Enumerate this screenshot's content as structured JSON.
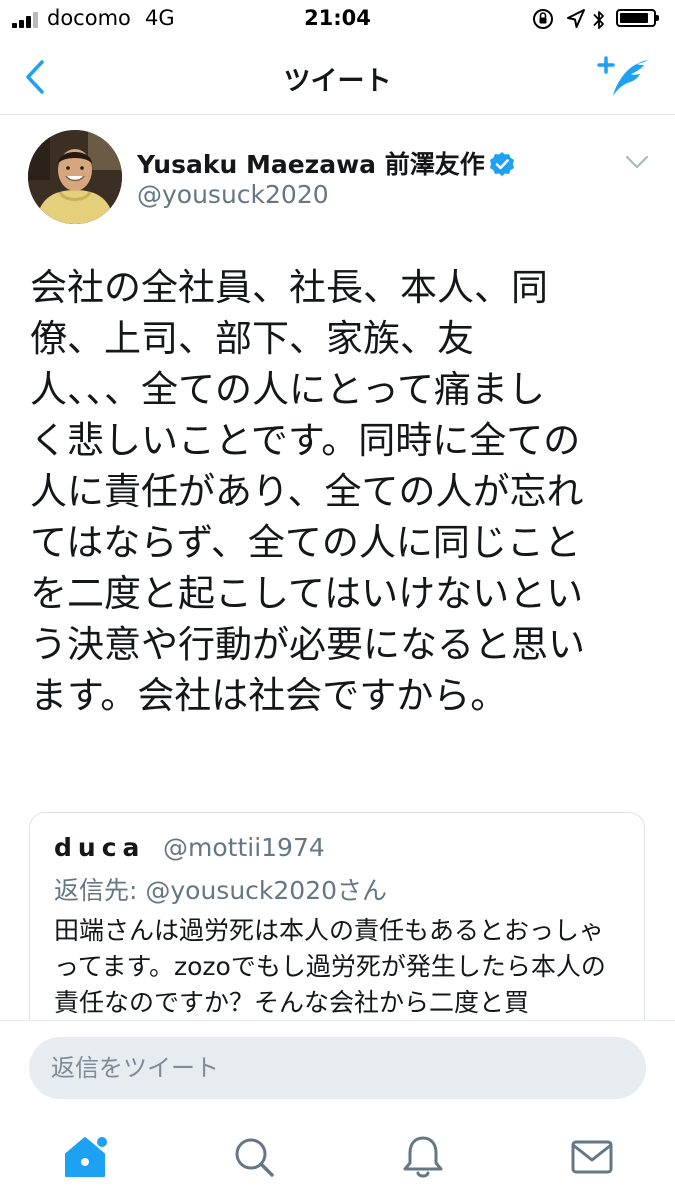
{
  "status_bar": {
    "carrier": "docomo",
    "network": "4G",
    "time": "21:04",
    "icons": [
      "signal-icon",
      "orientation-lock-icon",
      "location-icon",
      "bluetooth-icon",
      "battery-icon"
    ]
  },
  "nav": {
    "title": "ツイート",
    "back_icon": "chevron-left-icon",
    "compose_icon": "compose-tweet-icon"
  },
  "tweet": {
    "author_name": "Yusaku Maezawa 前澤友作",
    "handle": "@yousuck2020",
    "verified": true,
    "text": "会社の全社員、社長、本人、同\n僚、上司、部下、家族、友\n人、、、全ての人にとって痛まし\nく悲しいことです。同時に全ての\n人に責任があり、全ての人が忘れ\nてはならず、全ての人に同じこと\nを二度と起こしてはいけないとい\nう決意や行動が必要になると思い\nます。会社は社会ですから。"
  },
  "quoted_tweet": {
    "name": "duca",
    "handle": "@mottii1974",
    "reply_to": "返信先: @yousuck2020さん",
    "text": "田端さんは過労死は本人の責任もあるとおっしゃってます。zozoでもし過労死が発生したら本人の責任なのですか？そんな会社から二度と買"
  },
  "reply": {
    "placeholder": "返信をツイート"
  },
  "tabs": [
    "home-icon",
    "search-icon",
    "notifications-icon",
    "messages-icon"
  ],
  "colors": {
    "accent": "#1da1f2",
    "text": "#14171a",
    "secondary": "#657786",
    "input_bg": "#e6ecf0"
  }
}
